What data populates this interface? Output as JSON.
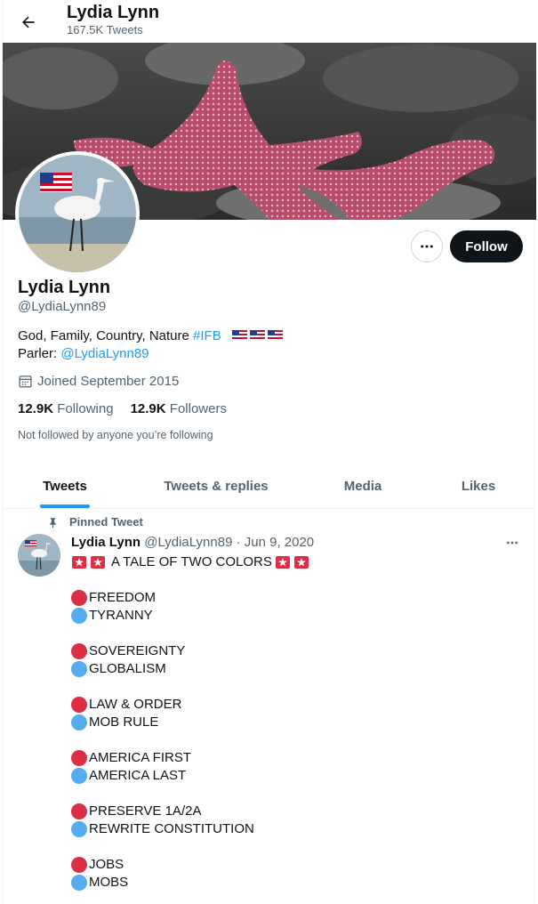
{
  "header": {
    "name": "Lydia Lynn",
    "tweet_count": "167.5K Tweets"
  },
  "profile": {
    "name": "Lydia Lynn",
    "handle": "@LydiaLynn89",
    "bio_text": "God, Family, Country, Nature ",
    "bio_hashtag": "#IFB",
    "parler_label": "Parler: ",
    "parler_handle": "@LydiaLynn89",
    "joined": "Joined September 2015",
    "following_count": "12.9K",
    "following_label": "Following",
    "followers_count": "12.9K",
    "followers_label": "Followers",
    "not_followed": "Not followed by anyone you’re following",
    "follow_label": "Follow"
  },
  "tabs": [
    {
      "label": "Tweets"
    },
    {
      "label": "Tweets & replies"
    },
    {
      "label": "Media"
    },
    {
      "label": "Likes"
    }
  ],
  "tweet": {
    "pinned_label": "Pinned Tweet",
    "author": "Lydia Lynn",
    "meta": " @LydiaLynn89 · Jun 9, 2020",
    "title": "A TALE OF TWO COLORS",
    "pairs": [
      {
        "red": "FREEDOM",
        "blue": "TYRANNY"
      },
      {
        "red": "SOVEREIGNTY",
        "blue": "GLOBALISM"
      },
      {
        "red": "LAW & ORDER",
        "blue": "MOB RULE"
      },
      {
        "red": "AMERICA FIRST",
        "blue": "AMERICA LAST"
      },
      {
        "red": "PRESERVE 1A/2A",
        "blue": "REWRITE CONSTITUTION"
      },
      {
        "red": "JOBS",
        "blue": "MOBS"
      }
    ]
  },
  "colors": {
    "accent": "#1d9bf0",
    "red_dot": "#dd2e44",
    "blue_dot": "#55acee"
  }
}
